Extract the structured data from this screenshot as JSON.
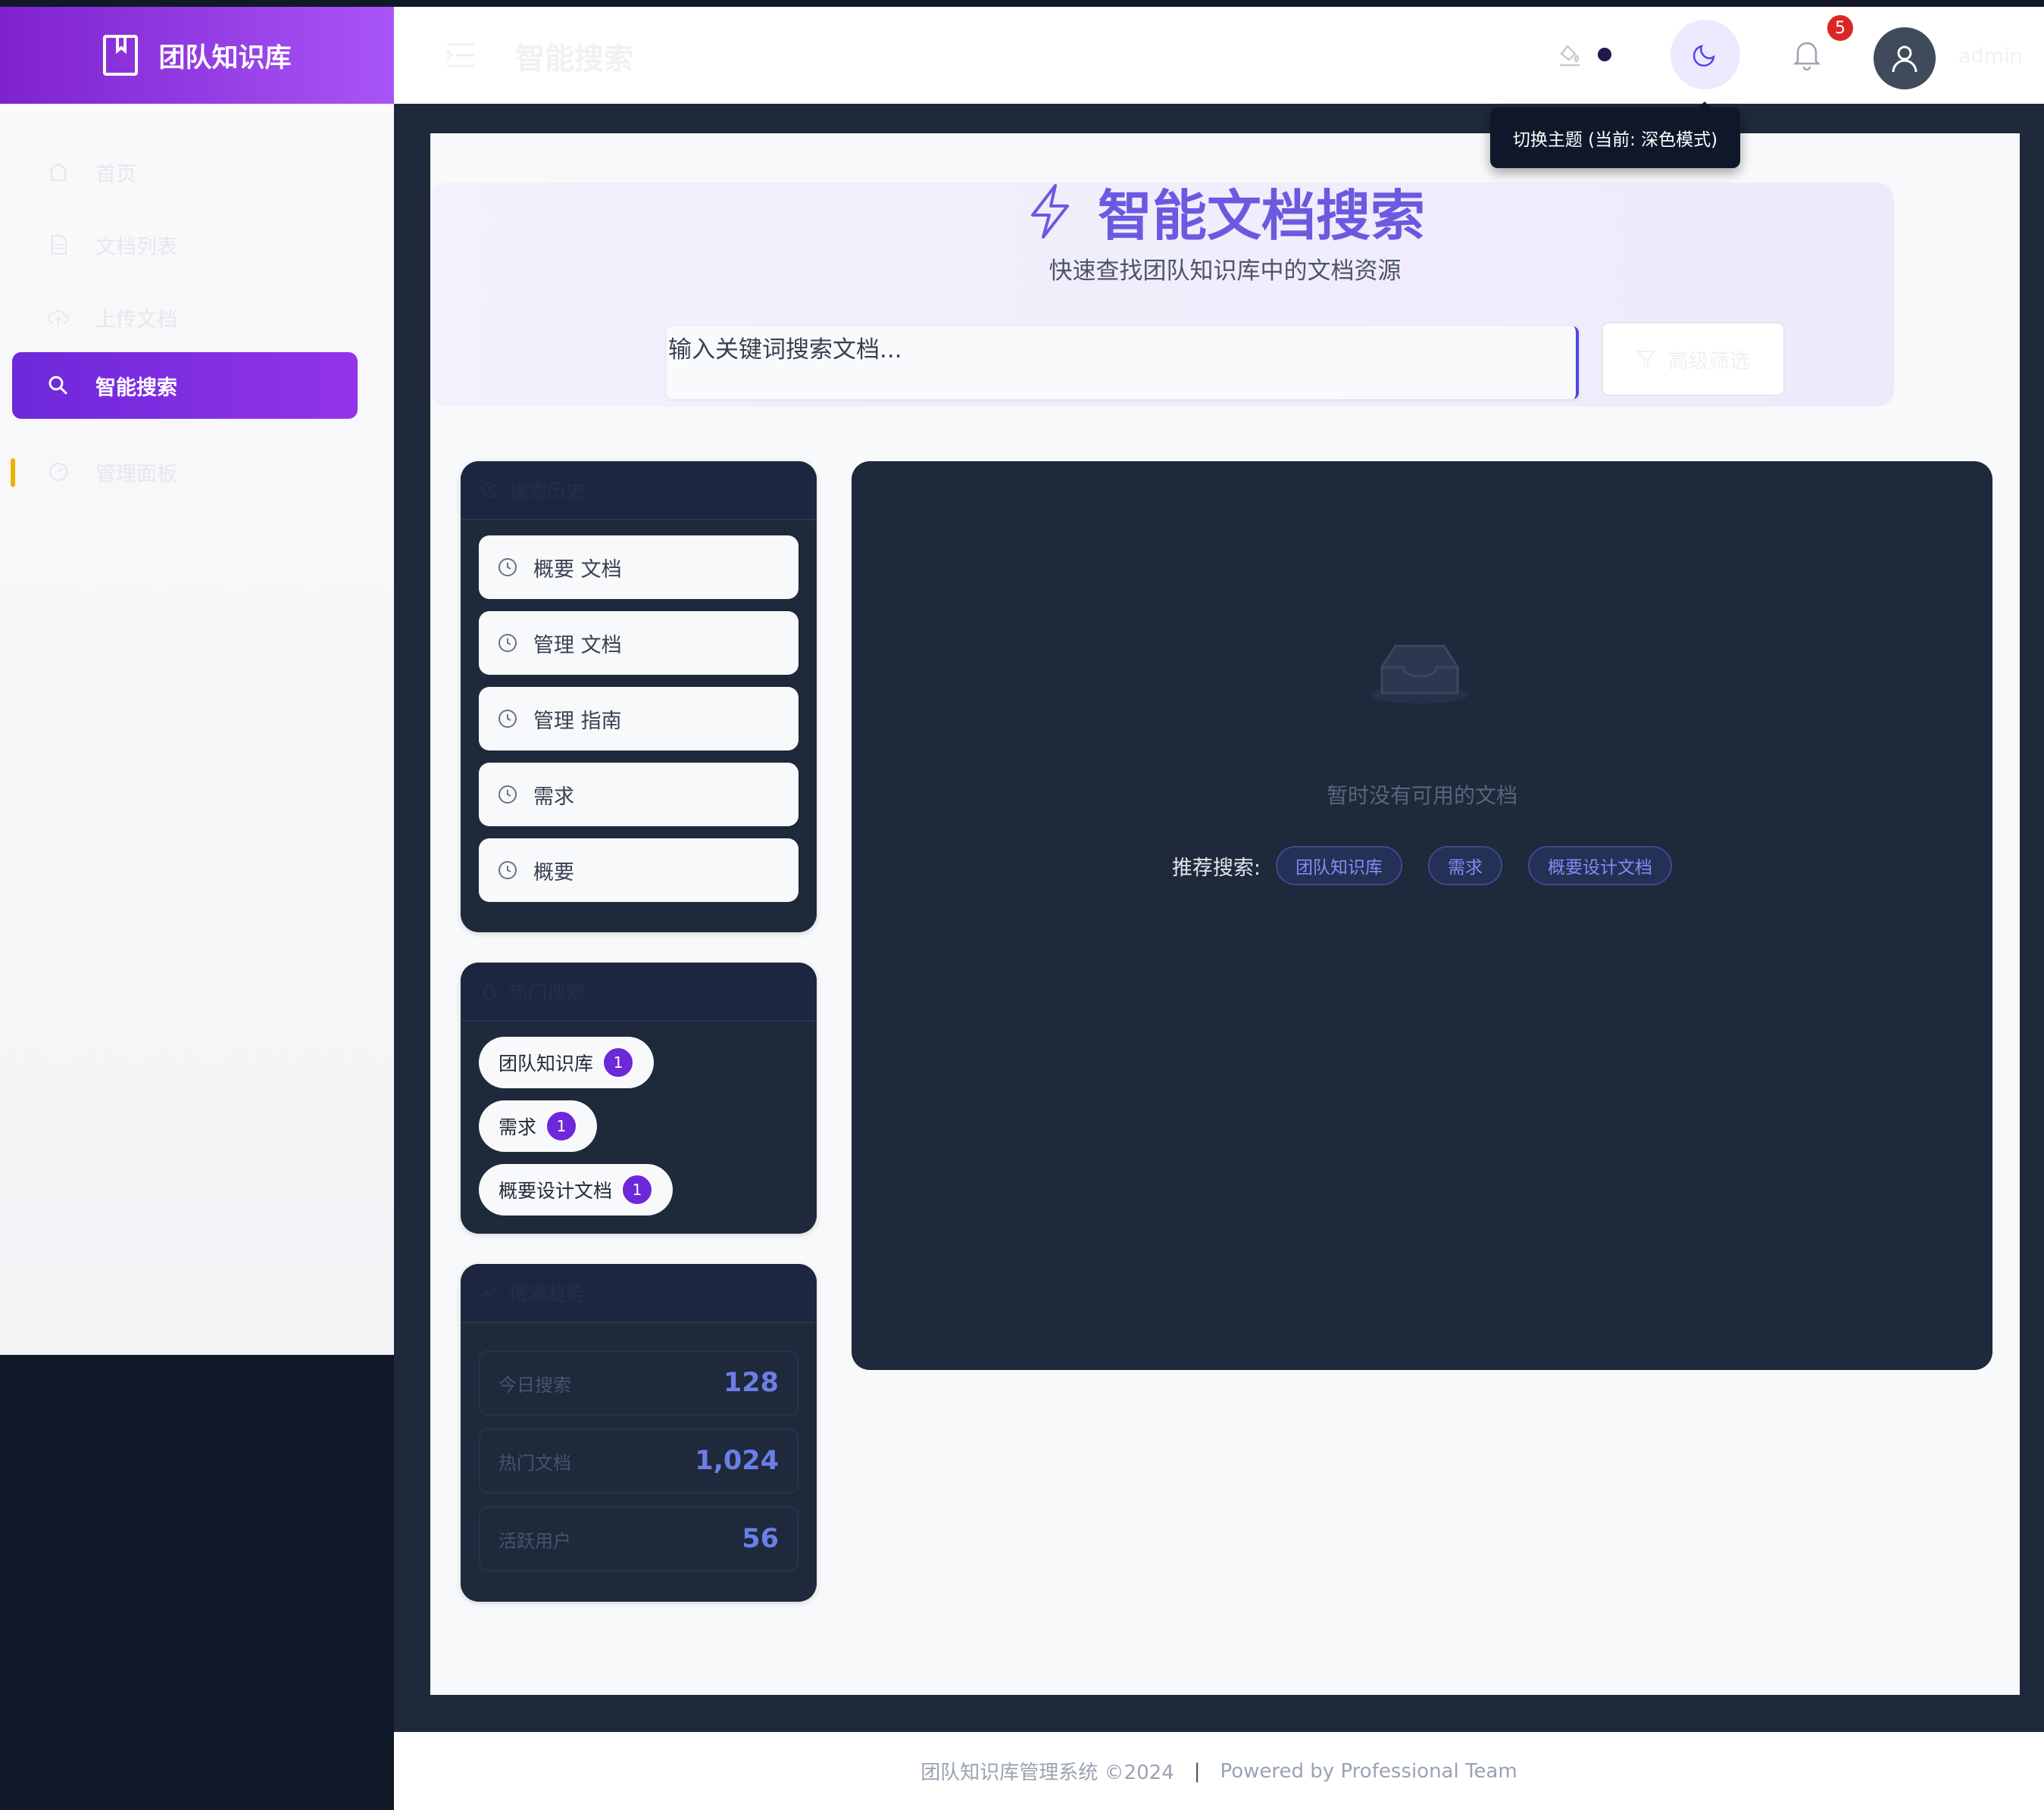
{
  "app": {
    "title": "团队知识库"
  },
  "sidebar": {
    "items": [
      {
        "label": "首页",
        "icon": "home-icon"
      },
      {
        "label": "文档列表",
        "icon": "document-icon"
      },
      {
        "label": "上传文档",
        "icon": "cloud-upload-icon"
      },
      {
        "label": "智能搜索",
        "icon": "search-icon",
        "active": true
      },
      {
        "label": "管理面板",
        "icon": "dashboard-icon"
      }
    ]
  },
  "header": {
    "page_title": "智能搜索",
    "notification_count": "5",
    "username": "admin",
    "theme_tooltip": "切换主题 (当前: 深色模式)"
  },
  "hero": {
    "title": "智能文档搜索",
    "subtitle": "快速查找团队知识库中的文档资源",
    "search_placeholder": "输入关键词搜索文档...",
    "advanced_filter_label": "高级筛选"
  },
  "history": {
    "title": "搜索历史",
    "items": [
      "概要 文档",
      "管理 文档",
      "管理 指南",
      "需求",
      "概要"
    ]
  },
  "hot": {
    "title": "热门搜索",
    "items": [
      {
        "label": "团队知识库",
        "count": "1"
      },
      {
        "label": "需求",
        "count": "1"
      },
      {
        "label": "概要设计文档",
        "count": "1"
      }
    ]
  },
  "stats": {
    "title": "搜索趋势",
    "rows": [
      {
        "label": "今日搜索",
        "value": "128"
      },
      {
        "label": "热门文档",
        "value": "1,024"
      },
      {
        "label": "活跃用户",
        "value": "56"
      }
    ]
  },
  "results": {
    "empty_text": "暂时没有可用的文档",
    "recommend_label": "推荐搜索:",
    "recommend_tags": [
      "团队知识库",
      "需求",
      "概要设计文档"
    ]
  },
  "footer": {
    "copyright": "团队知识库管理系统 ©2024",
    "separator": "|",
    "powered": "Powered by Professional Team"
  },
  "colors": {
    "brand_purple": "#7e22ce",
    "accent_indigo": "#6b5ae0",
    "dark_panel": "#1e293b",
    "badge_red": "#dc2626"
  }
}
